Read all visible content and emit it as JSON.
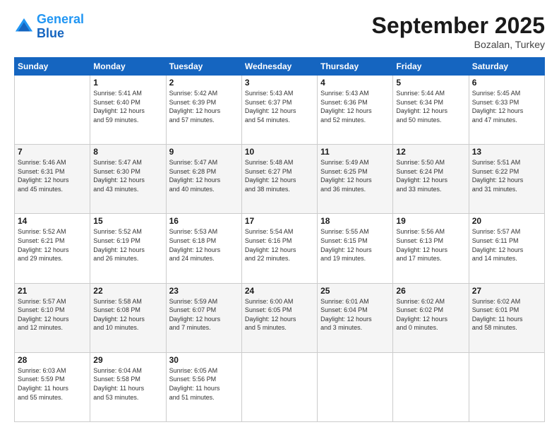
{
  "header": {
    "logo_line1": "General",
    "logo_line2": "Blue",
    "month": "September 2025",
    "location": "Bozalan, Turkey"
  },
  "days_of_week": [
    "Sunday",
    "Monday",
    "Tuesday",
    "Wednesday",
    "Thursday",
    "Friday",
    "Saturday"
  ],
  "weeks": [
    [
      {
        "day": "",
        "info": ""
      },
      {
        "day": "1",
        "info": "Sunrise: 5:41 AM\nSunset: 6:40 PM\nDaylight: 12 hours\nand 59 minutes."
      },
      {
        "day": "2",
        "info": "Sunrise: 5:42 AM\nSunset: 6:39 PM\nDaylight: 12 hours\nand 57 minutes."
      },
      {
        "day": "3",
        "info": "Sunrise: 5:43 AM\nSunset: 6:37 PM\nDaylight: 12 hours\nand 54 minutes."
      },
      {
        "day": "4",
        "info": "Sunrise: 5:43 AM\nSunset: 6:36 PM\nDaylight: 12 hours\nand 52 minutes."
      },
      {
        "day": "5",
        "info": "Sunrise: 5:44 AM\nSunset: 6:34 PM\nDaylight: 12 hours\nand 50 minutes."
      },
      {
        "day": "6",
        "info": "Sunrise: 5:45 AM\nSunset: 6:33 PM\nDaylight: 12 hours\nand 47 minutes."
      }
    ],
    [
      {
        "day": "7",
        "info": "Sunrise: 5:46 AM\nSunset: 6:31 PM\nDaylight: 12 hours\nand 45 minutes."
      },
      {
        "day": "8",
        "info": "Sunrise: 5:47 AM\nSunset: 6:30 PM\nDaylight: 12 hours\nand 43 minutes."
      },
      {
        "day": "9",
        "info": "Sunrise: 5:47 AM\nSunset: 6:28 PM\nDaylight: 12 hours\nand 40 minutes."
      },
      {
        "day": "10",
        "info": "Sunrise: 5:48 AM\nSunset: 6:27 PM\nDaylight: 12 hours\nand 38 minutes."
      },
      {
        "day": "11",
        "info": "Sunrise: 5:49 AM\nSunset: 6:25 PM\nDaylight: 12 hours\nand 36 minutes."
      },
      {
        "day": "12",
        "info": "Sunrise: 5:50 AM\nSunset: 6:24 PM\nDaylight: 12 hours\nand 33 minutes."
      },
      {
        "day": "13",
        "info": "Sunrise: 5:51 AM\nSunset: 6:22 PM\nDaylight: 12 hours\nand 31 minutes."
      }
    ],
    [
      {
        "day": "14",
        "info": "Sunrise: 5:52 AM\nSunset: 6:21 PM\nDaylight: 12 hours\nand 29 minutes."
      },
      {
        "day": "15",
        "info": "Sunrise: 5:52 AM\nSunset: 6:19 PM\nDaylight: 12 hours\nand 26 minutes."
      },
      {
        "day": "16",
        "info": "Sunrise: 5:53 AM\nSunset: 6:18 PM\nDaylight: 12 hours\nand 24 minutes."
      },
      {
        "day": "17",
        "info": "Sunrise: 5:54 AM\nSunset: 6:16 PM\nDaylight: 12 hours\nand 22 minutes."
      },
      {
        "day": "18",
        "info": "Sunrise: 5:55 AM\nSunset: 6:15 PM\nDaylight: 12 hours\nand 19 minutes."
      },
      {
        "day": "19",
        "info": "Sunrise: 5:56 AM\nSunset: 6:13 PM\nDaylight: 12 hours\nand 17 minutes."
      },
      {
        "day": "20",
        "info": "Sunrise: 5:57 AM\nSunset: 6:11 PM\nDaylight: 12 hours\nand 14 minutes."
      }
    ],
    [
      {
        "day": "21",
        "info": "Sunrise: 5:57 AM\nSunset: 6:10 PM\nDaylight: 12 hours\nand 12 minutes."
      },
      {
        "day": "22",
        "info": "Sunrise: 5:58 AM\nSunset: 6:08 PM\nDaylight: 12 hours\nand 10 minutes."
      },
      {
        "day": "23",
        "info": "Sunrise: 5:59 AM\nSunset: 6:07 PM\nDaylight: 12 hours\nand 7 minutes."
      },
      {
        "day": "24",
        "info": "Sunrise: 6:00 AM\nSunset: 6:05 PM\nDaylight: 12 hours\nand 5 minutes."
      },
      {
        "day": "25",
        "info": "Sunrise: 6:01 AM\nSunset: 6:04 PM\nDaylight: 12 hours\nand 3 minutes."
      },
      {
        "day": "26",
        "info": "Sunrise: 6:02 AM\nSunset: 6:02 PM\nDaylight: 12 hours\nand 0 minutes."
      },
      {
        "day": "27",
        "info": "Sunrise: 6:02 AM\nSunset: 6:01 PM\nDaylight: 11 hours\nand 58 minutes."
      }
    ],
    [
      {
        "day": "28",
        "info": "Sunrise: 6:03 AM\nSunset: 5:59 PM\nDaylight: 11 hours\nand 55 minutes."
      },
      {
        "day": "29",
        "info": "Sunrise: 6:04 AM\nSunset: 5:58 PM\nDaylight: 11 hours\nand 53 minutes."
      },
      {
        "day": "30",
        "info": "Sunrise: 6:05 AM\nSunset: 5:56 PM\nDaylight: 11 hours\nand 51 minutes."
      },
      {
        "day": "",
        "info": ""
      },
      {
        "day": "",
        "info": ""
      },
      {
        "day": "",
        "info": ""
      },
      {
        "day": "",
        "info": ""
      }
    ]
  ]
}
